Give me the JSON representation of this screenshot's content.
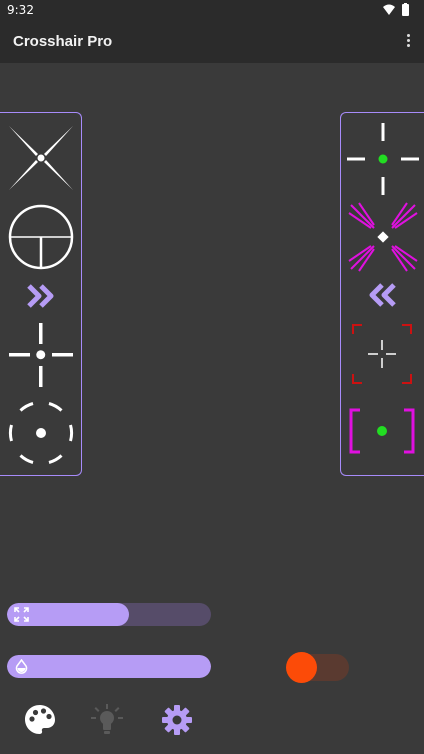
{
  "status_bar": {
    "time": "9:32",
    "icons": [
      "wifi-icon",
      "battery-icon"
    ]
  },
  "app_bar": {
    "title": "Crosshair Pro",
    "menu_icon": "more-vert-icon"
  },
  "left_panel": {
    "items": [
      "x-star-crosshair",
      "circle-scope-crosshair",
      "collapse-right-chevrons",
      "plus-gap-crosshair",
      "circle-dot-crosshair"
    ]
  },
  "right_panel": {
    "items": [
      "white-cross-green-dot",
      "magenta-x-crosshair",
      "collapse-left-chevrons",
      "red-brackets-crosshair",
      "magenta-brackets-green-dot"
    ]
  },
  "controls": {
    "size_slider": {
      "icon": "expand-icon",
      "value": 0.6
    },
    "opacity_slider": {
      "icon": "opacity-drop-icon",
      "value": 1.0
    },
    "toggle": {
      "on": true,
      "color": "#fc4b08"
    }
  },
  "bottom_nav": [
    {
      "icon": "palette-icon",
      "active": true
    },
    {
      "icon": "lightbulb-icon",
      "active": false
    },
    {
      "icon": "gear-icon",
      "active": true
    }
  ],
  "colors": {
    "background": "#3a3a3a",
    "bar": "#2b2b2b",
    "accent": "#b69cf5",
    "panel_border": "#a78bfa",
    "magenta": "#e010e0",
    "green": "#22dd22",
    "red": "#cc1111",
    "orange": "#fc4b08"
  }
}
